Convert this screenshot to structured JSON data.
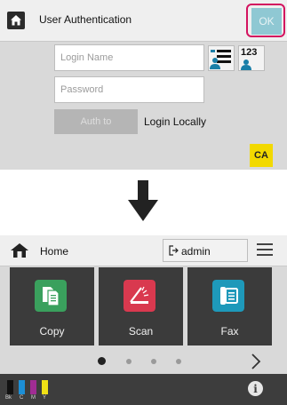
{
  "auth_screen": {
    "title": "User Authentication",
    "ok_label": "OK",
    "login_name_placeholder": "Login Name",
    "password_placeholder": "Password",
    "number_button_label": "123",
    "auth_to_label": "Auth to",
    "login_locally_label": "Login Locally",
    "ca_label": "CA",
    "ok_highlight_color": "#d3135f"
  },
  "home_screen": {
    "title": "Home",
    "user_label": "admin",
    "tiles": [
      {
        "label": "Copy",
        "icon": "copy-icon",
        "color": "#3aa05d"
      },
      {
        "label": "Scan",
        "icon": "scan-icon",
        "color": "#d9394f"
      },
      {
        "label": "Fax",
        "icon": "fax-icon",
        "color": "#1e99ba"
      }
    ],
    "page_indicator": {
      "current": 1,
      "total": 4
    },
    "toner": [
      {
        "label": "Bk",
        "color": "#111111"
      },
      {
        "label": "C",
        "color": "#1c8fd6"
      },
      {
        "label": "M",
        "color": "#a02c93"
      },
      {
        "label": "Y",
        "color": "#f0e016"
      }
    ]
  }
}
